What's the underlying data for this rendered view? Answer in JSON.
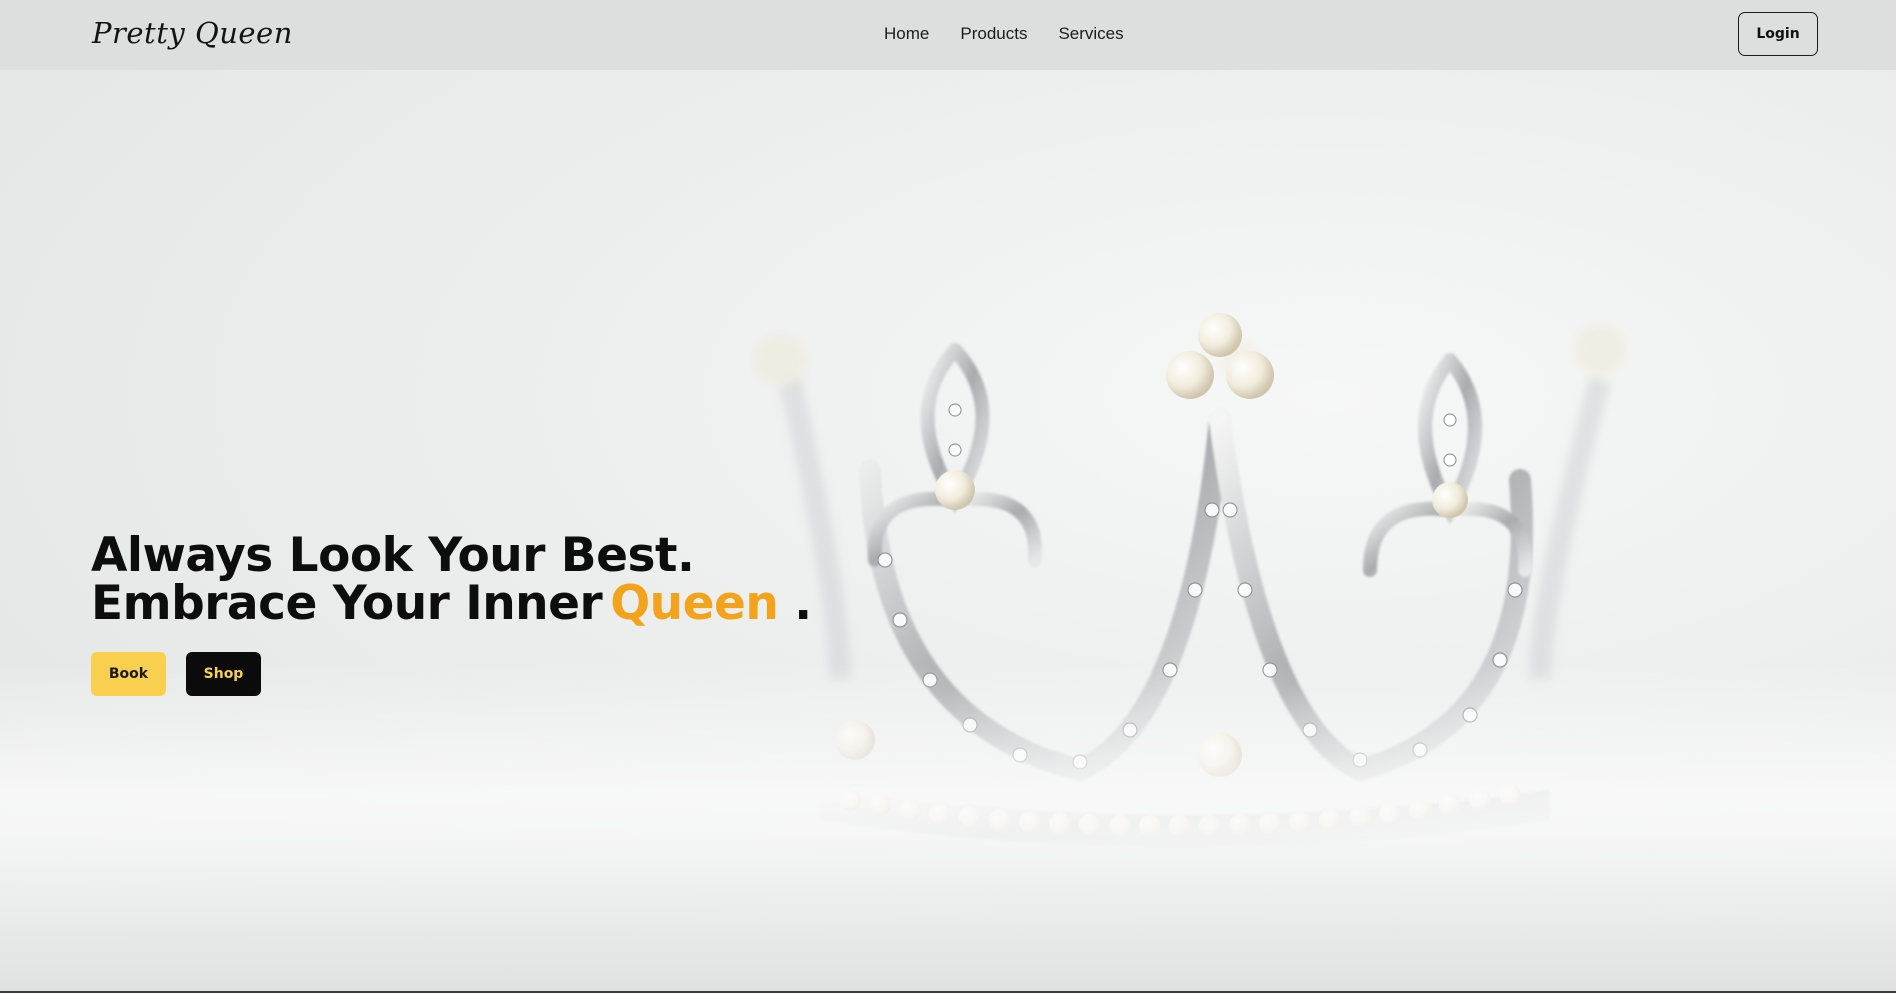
{
  "header": {
    "logo": "Pretty Queen",
    "nav": [
      "Home",
      "Products",
      "Services"
    ],
    "login_label": "Login"
  },
  "hero": {
    "line1": "Always Look Your Best.",
    "line2_prefix": "Embrace Your Inner",
    "line2_accent": "Queen",
    "line2_suffix": ".",
    "book_label": "Book",
    "shop_label": "Shop",
    "image": "crown-photo"
  },
  "colors": {
    "accent": "#f2a31b",
    "book_button": "#f8cf4f",
    "shop_button": "#0b0b0b",
    "header_bg": "#dcdfde"
  }
}
